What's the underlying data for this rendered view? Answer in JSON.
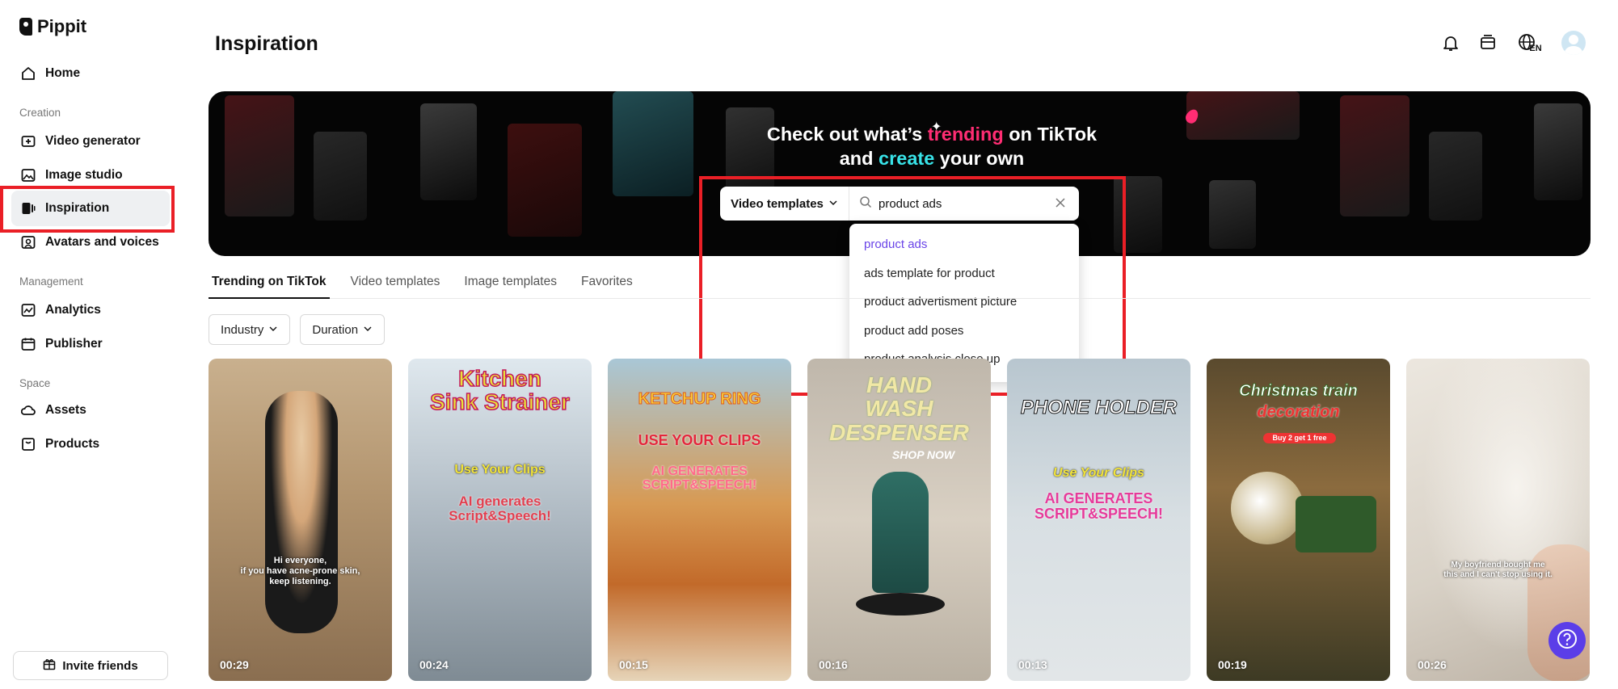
{
  "app": {
    "name": "Pippit"
  },
  "sidebar": {
    "home": "Home",
    "sections": {
      "creation": "Creation",
      "management": "Management",
      "space": "Space"
    },
    "items": {
      "video_generator": "Video generator",
      "image_studio": "Image studio",
      "inspiration": "Inspiration",
      "avatars_voices": "Avatars and voices",
      "analytics": "Analytics",
      "publisher": "Publisher",
      "assets": "Assets",
      "products": "Products"
    },
    "invite": "Invite friends"
  },
  "header": {
    "title": "Inspiration",
    "language": "EN"
  },
  "banner": {
    "line1_pre": "Check out what’s ",
    "line1_hot": "trending",
    "line1_post": " on TikTok",
    "line2_pre": "and ",
    "line2_hot": "create",
    "line2_post": " your own"
  },
  "search": {
    "type": "Video templates",
    "value": "product ads",
    "suggestions": [
      "product ads",
      "ads template for product",
      "product advertisment picture",
      "product add poses",
      "product analysis close up"
    ]
  },
  "tabs": [
    "Trending on TikTok",
    "Video templates",
    "Image templates",
    "Favorites"
  ],
  "filters": [
    "Industry",
    "Duration"
  ],
  "cards": [
    {
      "duration": "00:29",
      "caption": "Hi everyone,\nif you have acne-prone skin,\nkeep listening."
    },
    {
      "duration": "00:24",
      "title": "Kitchen\nSink Strainer",
      "sub1": "Use Your Clips",
      "sub2": "AI generates\nScript&Speech!"
    },
    {
      "duration": "00:15",
      "title": "KETCHUP RING",
      "sub1": "USE YOUR CLIPS",
      "sub2": "AI GENERATES\nSCRIPT&SPEECH!"
    },
    {
      "duration": "00:16",
      "title": "HAND\nWASH\nDESPENSER",
      "sub1": "SHOP NOW"
    },
    {
      "duration": "00:13",
      "title": "PHONE HOLDER",
      "sub1": "Use Your Clips",
      "sub2": "AI GENERATES\nSCRIPT&SPEECH!"
    },
    {
      "duration": "00:19",
      "title": "Christmas train",
      "sub1": "decoration",
      "sub2": "Buy 2 get 1 free"
    },
    {
      "duration": "00:26",
      "caption": "My boyfriend bought me\nthis and I can't stop using it."
    }
  ],
  "colors": {
    "accent": "#6a44e8",
    "trending": "#ff2d73",
    "create": "#38e3e8",
    "highlight": "#ea1f26"
  }
}
